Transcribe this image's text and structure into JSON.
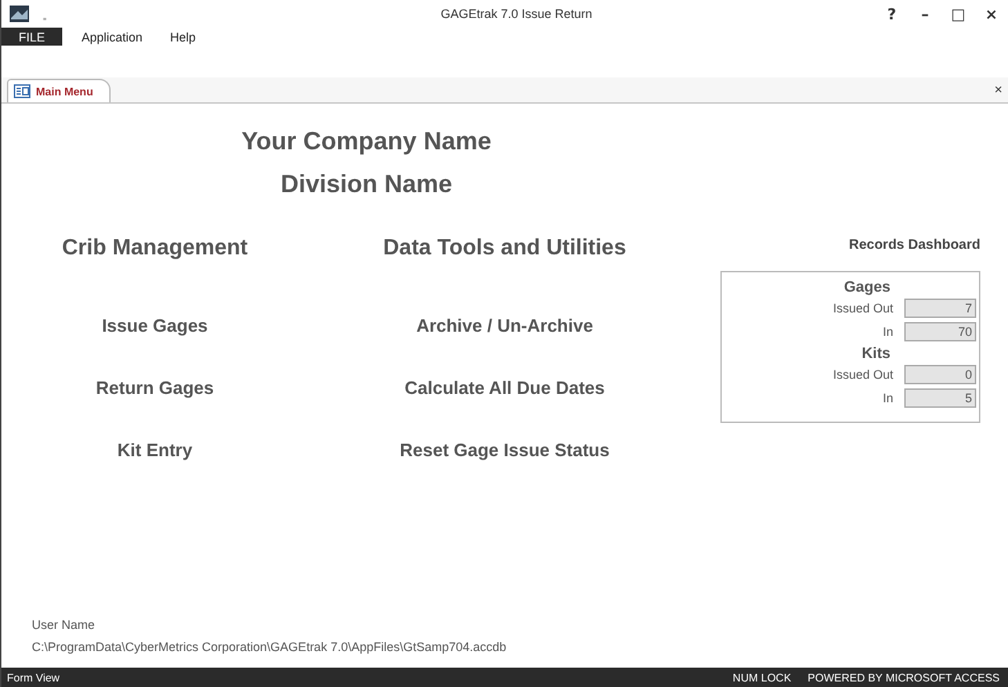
{
  "window": {
    "title": "GAGEtrak 7.0 Issue Return",
    "quick_access": "₌",
    "controls": [
      "?",
      "–",
      "□",
      "×"
    ]
  },
  "menu": [
    {
      "label": "FILE",
      "selected": true
    },
    {
      "label": "Application",
      "selected": false
    },
    {
      "label": "Help",
      "selected": false
    }
  ],
  "tabs": [
    {
      "label": "Main Menu",
      "selected": true
    }
  ],
  "tab_close": "×",
  "header": {
    "company": "Your Company Name",
    "division": "Division Name"
  },
  "columns": [
    {
      "heading": "Crib Management",
      "buttons": [
        "Issue Gages",
        "Return Gages",
        "Kit Entry"
      ]
    },
    {
      "heading": "Data Tools and Utilities",
      "buttons": [
        "Archive / Un-Archive",
        "Calculate All Due Dates",
        "Reset Gage Issue Status"
      ]
    }
  ],
  "dashboard": {
    "title": "Records Dashboard",
    "groups": [
      {
        "heading": "Gages",
        "rows": [
          {
            "label": "Issued Out",
            "value": "7"
          },
          {
            "label": "In",
            "value": "70"
          }
        ]
      },
      {
        "heading": "Kits",
        "rows": [
          {
            "label": "Issued Out",
            "value": "0"
          },
          {
            "label": "In",
            "value": "5"
          }
        ]
      }
    ]
  },
  "footer": {
    "user": "User Name",
    "path": "C:\\ProgramData\\CyberMetrics Corporation\\GAGEtrak 7.0\\AppFiles\\GtSamp704.accdb"
  },
  "status_bar": {
    "left": "Form View",
    "right": [
      "NUM LOCK",
      "POWERED BY MICROSOFT ACCESS"
    ]
  }
}
